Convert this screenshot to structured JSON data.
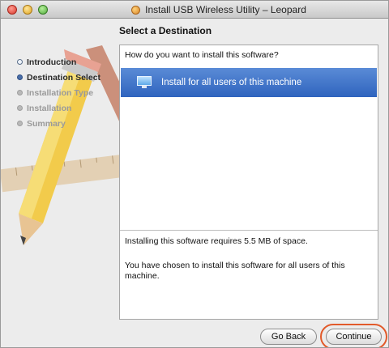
{
  "window": {
    "title": "Install USB Wireless Utility – Leopard"
  },
  "page": {
    "heading": "Select a Destination"
  },
  "sidebar": {
    "steps": [
      {
        "label": "Introduction",
        "state": "done"
      },
      {
        "label": "Destination Select",
        "state": "current"
      },
      {
        "label": "Installation Type",
        "state": "pending"
      },
      {
        "label": "Installation",
        "state": "pending"
      },
      {
        "label": "Summary",
        "state": "pending"
      }
    ]
  },
  "content": {
    "question": "How do you want to install this software?",
    "option_label": "Install for all users of this machine",
    "space_info": "Installing this software requires 5.5 MB of space.",
    "choice_info": "You have chosen to install this software for all users of this machine."
  },
  "buttons": {
    "go_back": "Go Back",
    "continue": "Continue"
  },
  "colors": {
    "selection": "#3a6fc7",
    "highlight_ring": "#e25a2a"
  }
}
